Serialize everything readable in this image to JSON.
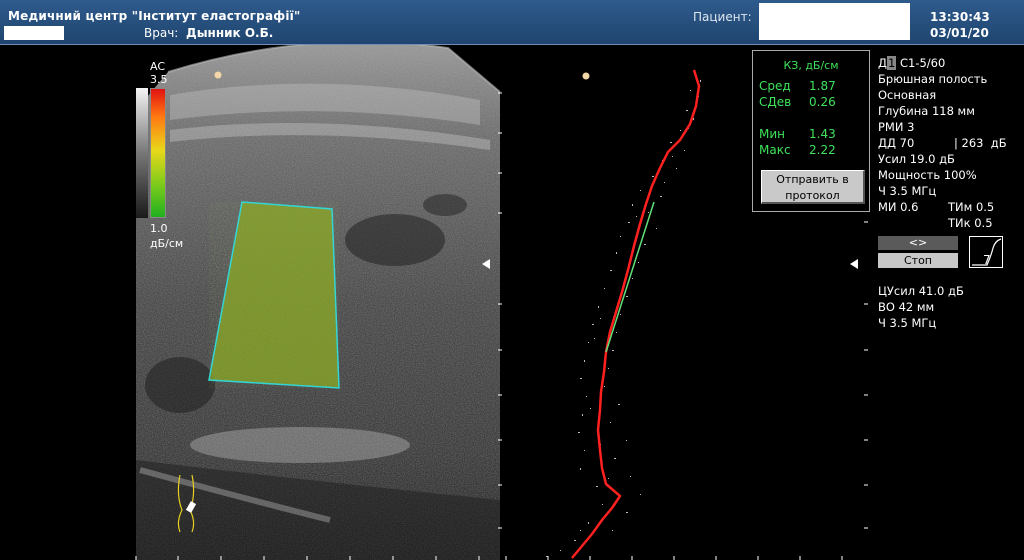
{
  "header": {
    "clinic_title": "Медичний центр \"Інститут еластографії\"",
    "doctor_label": "Врач:",
    "doctor_name": "Дынник О.Б.",
    "patient_label": "Пациент:",
    "time": "13:30:43",
    "date": "03/01/20"
  },
  "scale": {
    "label": "AC",
    "max": "3.5",
    "min": "1.0",
    "unit": "дБ/см"
  },
  "results": {
    "title": "КЗ, дБ/см",
    "mean_label": "Сред",
    "mean_value": "1.87",
    "sd_label": "СДев",
    "sd_value": "0.26",
    "min_label": "Мин",
    "min_value": "1.43",
    "max_label": "Макс",
    "max_value": "2.22",
    "send_button_line1": "Отправить в",
    "send_button_line2": "протокол"
  },
  "params": {
    "probe_prefix": "Д",
    "probe_index": "1",
    "probe": "С1-5/60",
    "region": "Брюшная полость",
    "preset": "Основная",
    "depth": "Глубина 118 мм",
    "rmi": "РМИ 3",
    "dd": "ДД 70",
    "dd_db": "| 263  дБ",
    "gain": "Усил 19.0 дБ",
    "power": "Мощность 100%",
    "freq": "Ч 3.5 МГц",
    "mi": "МИ 0.6",
    "tim": "ТИм 0.5",
    "tik": "ТИк 0.5",
    "cgain": "ЦУсил 41.0 дБ",
    "vo": "ВО 42 мм",
    "freq2": "Ч 3.5 МГц"
  },
  "controls": {
    "nav_label": "<>",
    "stop_label": "Стоп"
  },
  "colors": {
    "header_bg": "#2e5a8c",
    "result_text": "#3fe25a",
    "roi_outline": "#33d6d6",
    "profile_red": "#ff2020"
  }
}
